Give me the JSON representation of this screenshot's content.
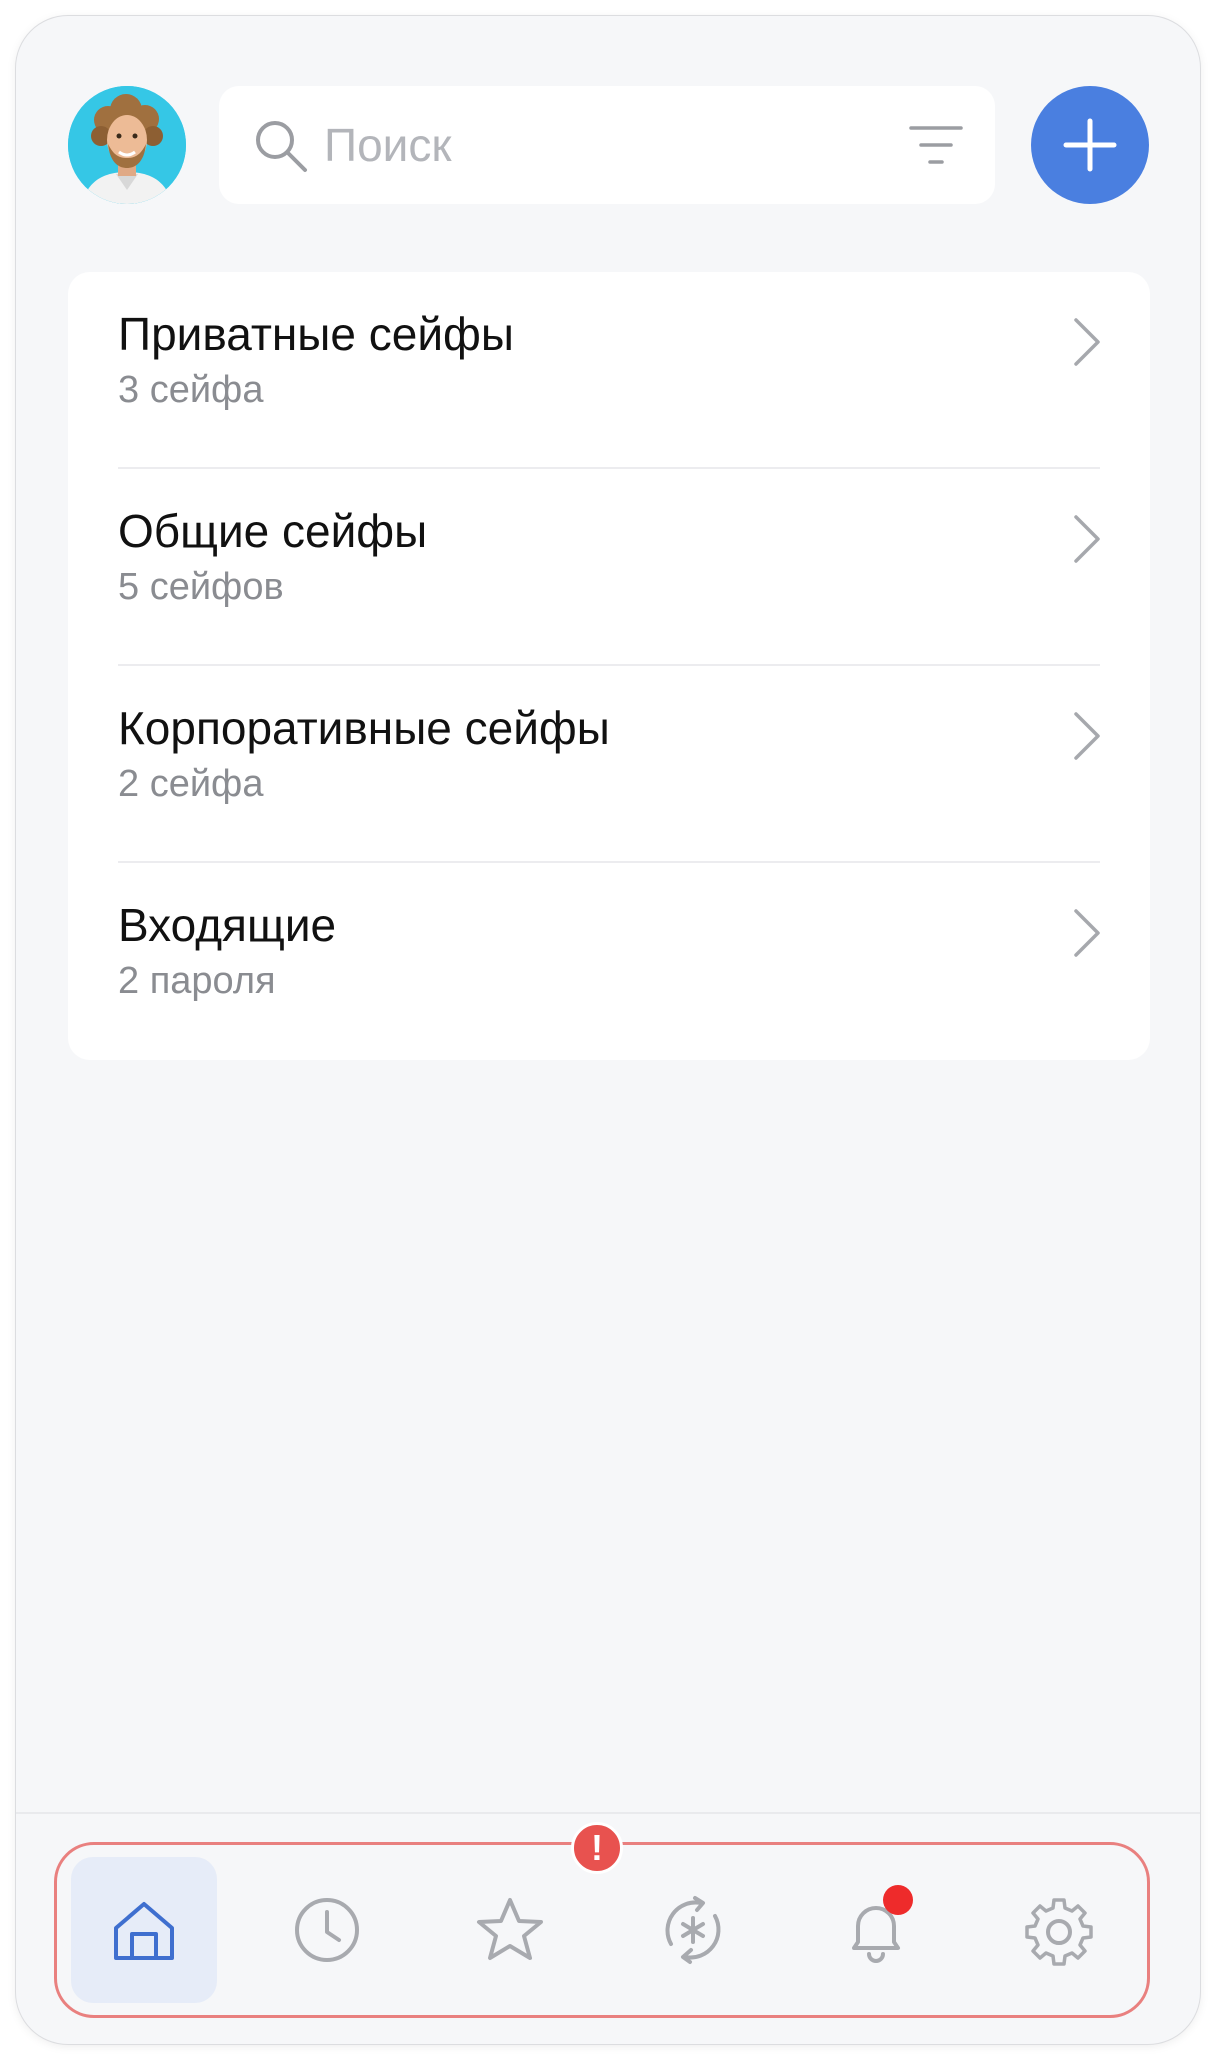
{
  "search": {
    "placeholder": "Поиск",
    "value": ""
  },
  "vault_sections": [
    {
      "title": "Приватные сейфы",
      "subtitle": "3 сейфа"
    },
    {
      "title": "Общие сейфы",
      "subtitle": "5 сейфов"
    },
    {
      "title": "Корпоративные сейфы",
      "subtitle": "2 сейфа"
    },
    {
      "title": "Входящие",
      "subtitle": "2 пароля"
    }
  ],
  "bottom_nav": {
    "items": [
      {
        "icon": "home-icon",
        "active": true
      },
      {
        "icon": "clock-icon",
        "active": false
      },
      {
        "icon": "star-icon",
        "active": false
      },
      {
        "icon": "password-sync-icon",
        "active": false
      },
      {
        "icon": "bell-icon",
        "active": false,
        "notification_dot": true
      },
      {
        "icon": "gear-icon",
        "active": false
      }
    ],
    "warning_badge": "!"
  },
  "colors": {
    "accent": "#4a7fe0",
    "background": "#f6f7f9",
    "active_nav_bg": "#e6ecf8",
    "highlight_border": "#e9807f",
    "notification_dot": "#ee2b2b",
    "avatar_bg": "#35c7e6"
  }
}
